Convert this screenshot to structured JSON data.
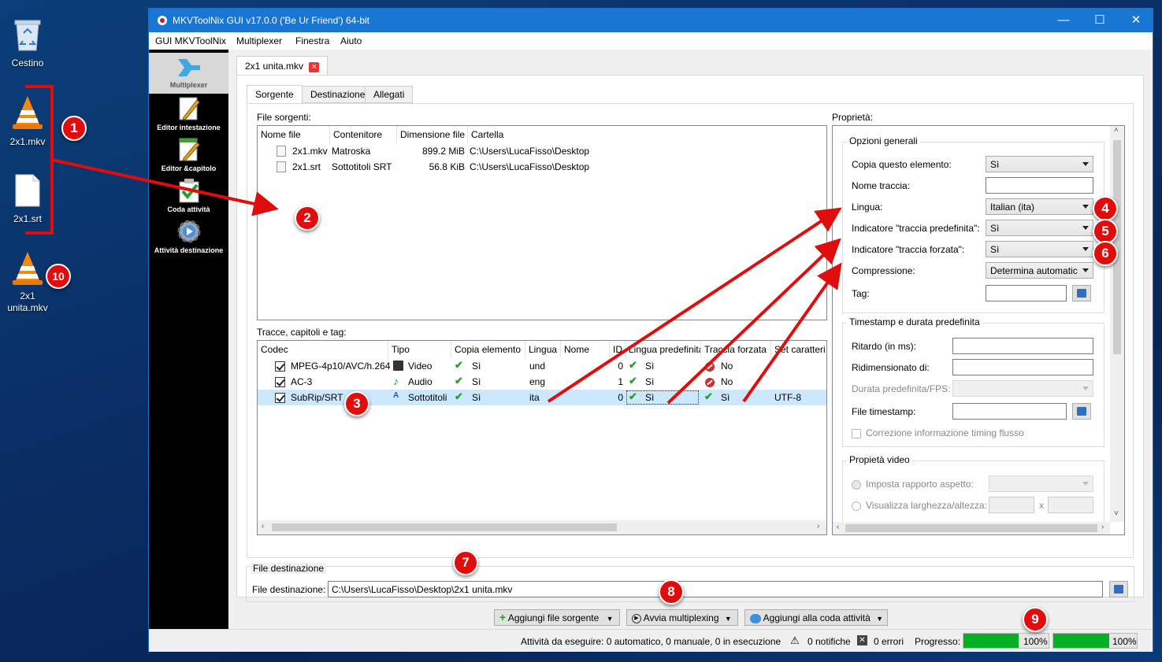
{
  "desktop": {
    "icons": [
      {
        "label": "Cestino",
        "icon": "recycle-bin-icon"
      },
      {
        "label": "2x1.mkv",
        "icon": "vlc-icon"
      },
      {
        "label": "2x1.srt",
        "icon": "file-icon"
      },
      {
        "label": "2x1\nunita.mkv",
        "icon": "vlc-icon"
      }
    ]
  },
  "annotations": [
    "1",
    "2",
    "3",
    "4",
    "5",
    "6",
    "7",
    "8",
    "9",
    "10"
  ],
  "annotation_color": "#e10d0d",
  "window": {
    "title": "MKVToolNix GUI v17.0.0 ('Be Ur Friend') 64-bit",
    "controls": {
      "minimize": "—",
      "maximize": "☐",
      "close": "✕"
    },
    "titlebar_color": "#1976d2"
  },
  "menu": [
    "GUI MKVToolNix",
    "Multiplexer",
    "Finestra",
    "Aiuto"
  ],
  "sidebar": [
    {
      "label": "Multiplexer",
      "icon": "multiplexer-icon"
    },
    {
      "label": "Editor intestazione",
      "icon": "header-editor-icon"
    },
    {
      "label": "Editor &capitolo",
      "icon": "chapter-editor-icon"
    },
    {
      "label": "Coda attività",
      "icon": "job-queue-icon"
    },
    {
      "label": "Attività destinazione",
      "icon": "job-output-icon"
    }
  ],
  "file_tab": {
    "label": "2x1 unita.mkv",
    "close": "×"
  },
  "subtabs": [
    "Sorgente",
    "Destinazione",
    "Allegati"
  ],
  "sources": {
    "title": "File sorgenti:",
    "headers": [
      "Nome file",
      "Contenitore",
      "Dimensione file",
      "Cartella"
    ],
    "rows": [
      {
        "name": "2x1.mkv",
        "container": "Matroska",
        "size": "899.2 MiB",
        "folder": "C:\\Users\\LucaFisso\\Desktop"
      },
      {
        "name": "2x1.srt",
        "container": "Sottotitoli SRT",
        "size": "56.8 KiB",
        "folder": "C:\\Users\\LucaFisso\\Desktop"
      }
    ]
  },
  "tracks": {
    "title": "Tracce, capitoli e tag:",
    "headers": [
      "Codec",
      "Tipo",
      "Copia elemento",
      "Lingua",
      "Nome",
      "ID",
      "Lingua predefinita",
      "Traccia forzata",
      "Set caratteri"
    ],
    "rows": [
      {
        "codec": "MPEG-4p10/AVC/h.264",
        "type": "Video",
        "copy": "Sì",
        "lang": "und",
        "id": "0",
        "default": "Sì",
        "forced": "No",
        "charset": ""
      },
      {
        "codec": "AC-3",
        "type": "Audio",
        "copy": "Sì",
        "lang": "eng",
        "id": "1",
        "default": "Sì",
        "forced": "No",
        "charset": ""
      },
      {
        "codec": "SubRip/SRT",
        "type": "Sottotitoli",
        "copy": "Sì",
        "lang": "ita",
        "id": "0",
        "default": "Sì",
        "forced": "Sì",
        "charset": "UTF-8"
      }
    ]
  },
  "properties": {
    "title": "Proprietà:",
    "general": {
      "title": "Opzioni generali",
      "copy_label": "Copia questo elemento:",
      "copy_value": "Sì",
      "name_label": "Nome traccia:",
      "name_value": "",
      "lang_label": "Lingua:",
      "lang_value": "Italian (ita)",
      "default_label": "Indicatore \"traccia predefinita\":",
      "default_value": "Sì",
      "forced_label": "Indicatore \"traccia forzata\":",
      "forced_value": "Sì",
      "compress_label": "Compressione:",
      "compress_value": "Determina automatic",
      "tag_label": "Tag:",
      "tag_value": ""
    },
    "timestamps": {
      "title": "Timestamp e durata predefinita",
      "delay_label": "Ritardo (in ms):",
      "stretch_label": "Ridimensionato di:",
      "duration_label": "Durata predefinita/FPS:",
      "file_label": "File timestamp:",
      "fix_label": "Correzione informazione timing flusso"
    },
    "video": {
      "title": "Propietà video",
      "aspect_label": "Imposta rapporto aspetto:",
      "display_label": "Visualizza larghezza/altezza:",
      "x": "x"
    }
  },
  "destination": {
    "group_title": "File destinazione",
    "label": "File destinazione:",
    "value": "C:\\Users\\LucaFisso\\Desktop\\2x1 unita.mkv"
  },
  "buttons": {
    "add_source": "Aggiungi file sorgente",
    "start_mux": "Avvia multiplexing",
    "add_queue": "Aggiungi alla coda attività"
  },
  "status": {
    "jobs": "Attività da eseguire:  0 automatico, 0 manuale, 0 in esecuzione",
    "notifications": "0 notifiche",
    "errors": "0 errori",
    "progress_label": "Progresso:",
    "progress1": "100%",
    "progress2": "100%",
    "progress1_value": 1.0,
    "progress2_value": 1.0
  }
}
